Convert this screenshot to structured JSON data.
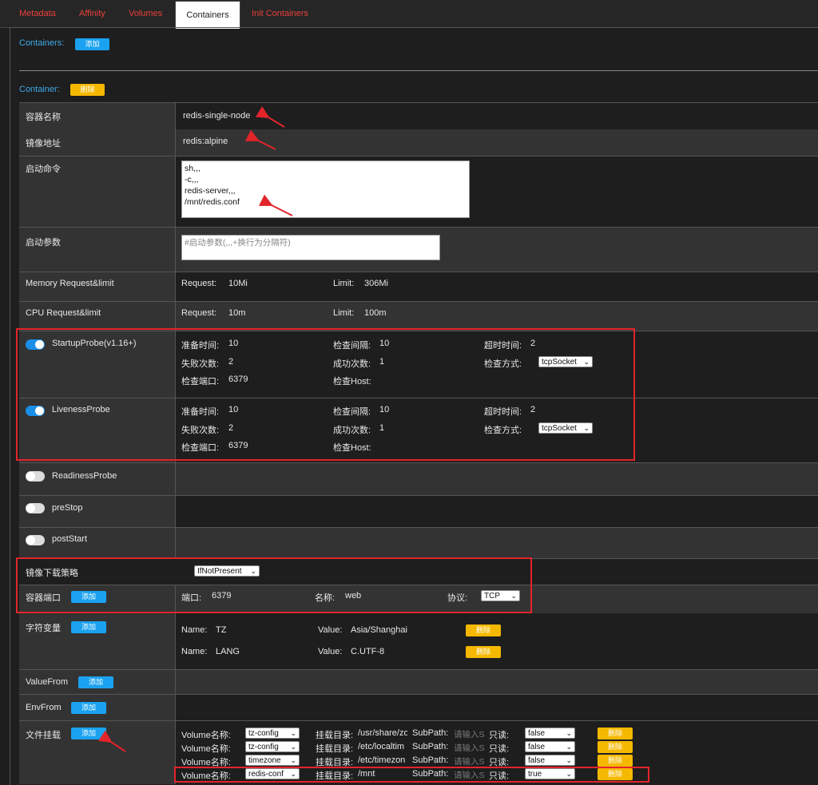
{
  "tabs": [
    "Metadata",
    "Affinity",
    "Volumes",
    "Containers",
    "Init Containers"
  ],
  "containers_label": "Containers:",
  "add_label": "添加",
  "container_label": "Container:",
  "delete_label": "删除",
  "fields": {
    "name_label": "容器名称",
    "name_value": "redis-single-node",
    "image_label": "镜像地址",
    "image_value": "redis:alpine",
    "command_label": "启动命令",
    "command_value": "sh,,,\n-c,,,\nredis-server,,,\n/mnt/redis.conf",
    "args_label": "启动参数",
    "args_placeholder": "#启动参数(,,,+换行为分隔符)",
    "memory_label": "Memory Request&limit",
    "memory_request_label": "Request:",
    "memory_request": "10Mi",
    "memory_limit_label": "Limit:",
    "memory_limit": "306Mi",
    "cpu_label": "CPU Request&limit",
    "cpu_request_label": "Request:",
    "cpu_request": "10m",
    "cpu_limit_label": "Limit:",
    "cpu_limit": "100m"
  },
  "probes": [
    {
      "name": "StartupProbe(v1.16+)",
      "enabled": true,
      "initial_delay_label": "准备时间:",
      "initial_delay": "10",
      "period_label": "检查间隔:",
      "period": "10",
      "timeout_label": "超时时间:",
      "timeout": "2",
      "failure_label": "失败次数:",
      "failure": "2",
      "success_label": "成功次数:",
      "success": "1",
      "method_label": "检查方式:",
      "method": "tcpSocket",
      "port_label": "检查端口:",
      "port": "6379",
      "host_label": "检查Host:"
    },
    {
      "name": "LivenessProbe",
      "enabled": true,
      "initial_delay_label": "准备时间:",
      "initial_delay": "10",
      "period_label": "检查间隔:",
      "period": "10",
      "timeout_label": "超时时间:",
      "timeout": "2",
      "failure_label": "失败次数:",
      "failure": "2",
      "success_label": "成功次数:",
      "success": "1",
      "method_label": "检查方式:",
      "method": "tcpSocket",
      "port_label": "检查端口:",
      "port": "6379",
      "host_label": "检查Host:"
    }
  ],
  "toggles": [
    {
      "name": "ReadinessProbe",
      "enabled": false
    },
    {
      "name": "preStop",
      "enabled": false
    },
    {
      "name": "postStart",
      "enabled": false
    }
  ],
  "pull_policy": {
    "label": "镜像下载策略",
    "value": "IfNotPresent"
  },
  "ports": {
    "label": "容器端口",
    "port_label": "端口:",
    "port": "6379",
    "name_label": "名称:",
    "name": "web",
    "protocol_label": "协议:",
    "protocol": "TCP"
  },
  "env": {
    "label": "字符变量",
    "items": [
      {
        "name_label": "Name:",
        "name": "TZ",
        "value_label": "Value:",
        "value": "Asia/Shanghai"
      },
      {
        "name_label": "Name:",
        "name": "LANG",
        "value_label": "Value:",
        "value": "C.UTF-8"
      }
    ]
  },
  "value_from_label": "ValueFrom",
  "env_from_label": "EnvFrom",
  "mounts": {
    "label": "文件挂载",
    "items": [
      {
        "vol_label": "Volume名称:",
        "volume": "tz-config",
        "path_label": "挂载目录:",
        "path": "/usr/share/zo",
        "subpath_label": "SubPath:",
        "subpath_placeholder": "请输入S",
        "ro_label": "只读:",
        "readonly": "false"
      },
      {
        "vol_label": "Volume名称:",
        "volume": "tz-config",
        "path_label": "挂载目录:",
        "path": "/etc/localtim",
        "subpath_label": "SubPath:",
        "subpath_placeholder": "请输入S",
        "ro_label": "只读:",
        "readonly": "false"
      },
      {
        "vol_label": "Volume名称:",
        "volume": "timezone",
        "path_label": "挂载目录:",
        "path": "/etc/timezon",
        "subpath_label": "SubPath:",
        "subpath_placeholder": "请输入S",
        "ro_label": "只读:",
        "readonly": "false"
      },
      {
        "vol_label": "Volume名称:",
        "volume": "redis-conf",
        "path_label": "挂载目录:",
        "path": "/mnt",
        "subpath_label": "SubPath:",
        "subpath_placeholder": "请输入S",
        "ro_label": "只读:",
        "readonly": "true"
      }
    ]
  },
  "colors": {
    "accent_blue": "#1aa2f0",
    "delete_yellow": "#f5b800",
    "tab_red": "#e8413c",
    "annotation_red": "#e3242b"
  }
}
